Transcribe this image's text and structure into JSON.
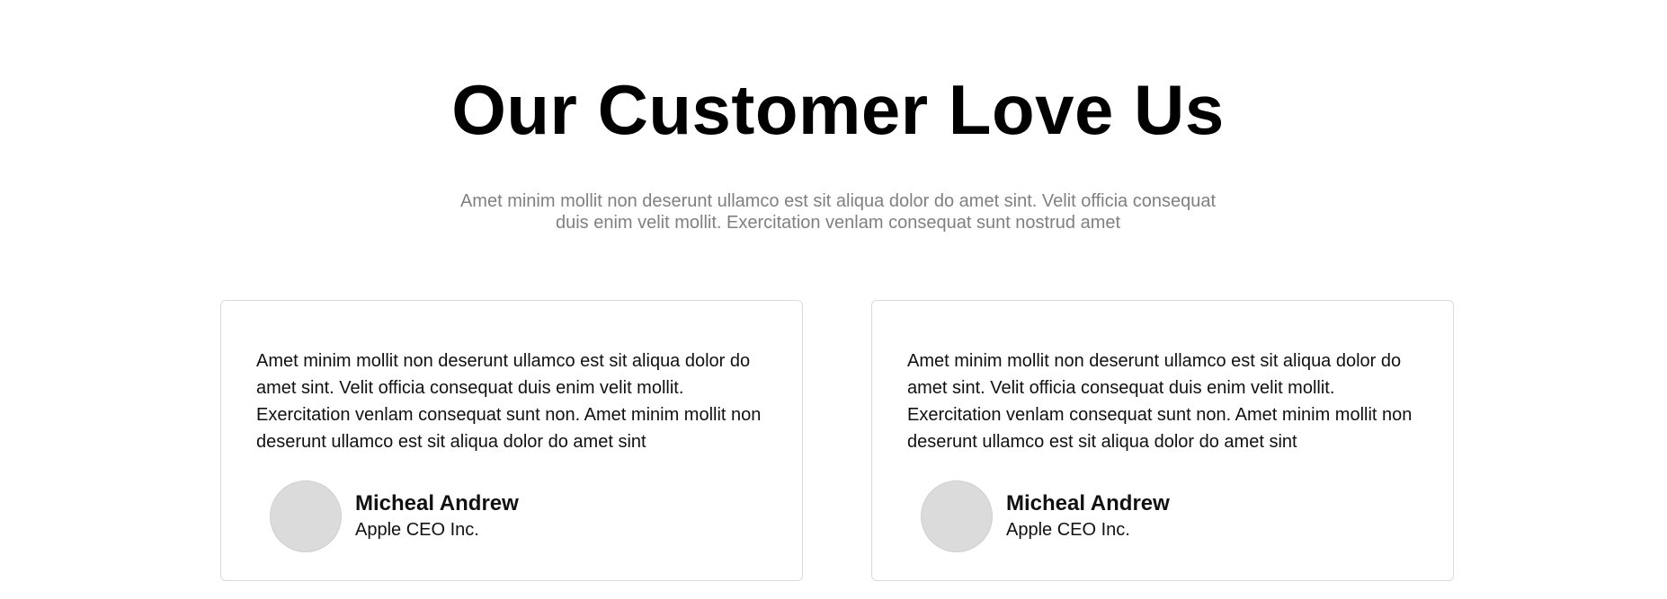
{
  "header": {
    "title": "Our Customer Love Us",
    "subtitle": "Amet minim mollit non deserunt ullamco est sit aliqua dolor do amet sint. Velit officia consequat duis enim velit mollit. Exercitation venlam consequat sunt nostrud amet"
  },
  "testimonials": [
    {
      "quote": "Amet minim mollit non deserunt ullamco est sit aliqua dolor do amet sint. Velit officia consequat duis enim velit mollit. Exercitation venlam consequat sunt non. Amet minim mollit non deserunt ullamco est sit aliqua dolor do amet sint",
      "name": "Micheal Andrew",
      "role": "Apple CEO Inc."
    },
    {
      "quote": "Amet minim mollit non deserunt ullamco est sit aliqua dolor do amet sint. Velit officia consequat duis enim velit mollit. Exercitation venlam consequat sunt non. Amet minim mollit non deserunt ullamco est sit aliqua dolor do amet sint",
      "name": "Micheal Andrew",
      "role": "Apple CEO Inc."
    }
  ],
  "colors": {
    "title": "#000000",
    "subtitle": "#808080",
    "card_border": "#dadada",
    "avatar_placeholder": "#dbdbdb"
  }
}
